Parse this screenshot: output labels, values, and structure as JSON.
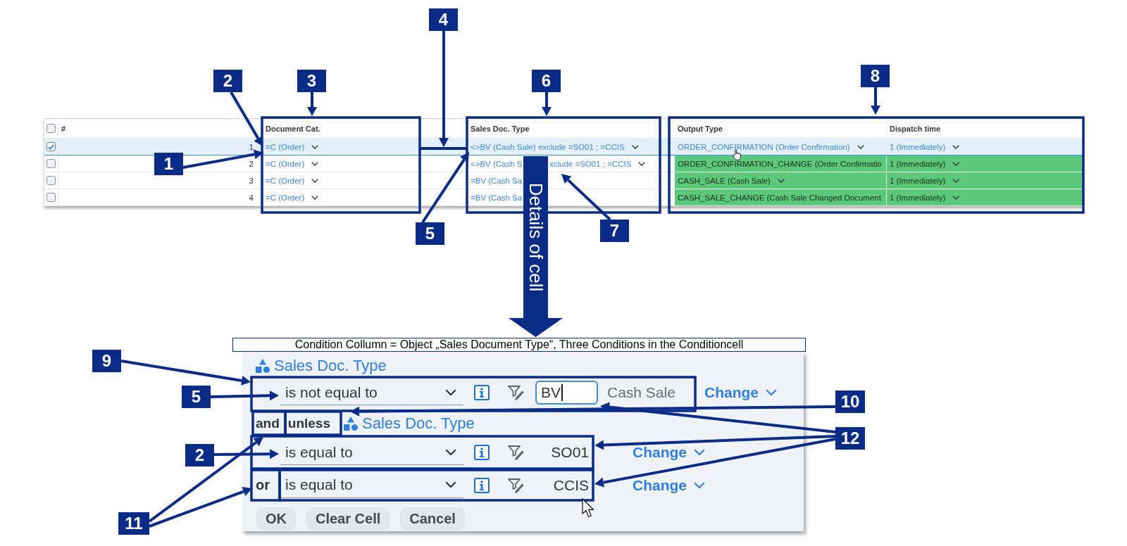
{
  "table": {
    "select_all": {
      "checked": false
    },
    "columns": [
      {
        "label": "#"
      },
      {
        "label": "Document Cat."
      },
      {
        "label": "Sales Doc. Type"
      },
      {
        "label": "Output Type"
      },
      {
        "label": "Dispatch time"
      }
    ],
    "rows": [
      {
        "selected": true,
        "highlighted": false,
        "cells": [
          {
            "text": "1",
            "dropdown": false
          },
          {
            "text": "=C (Order)",
            "dropdown": true
          },
          {
            "text": "<>BV (Cash Sale) exclude =SO01 ; =CCIS",
            "dropdown": true
          },
          {
            "text": "ORDER_CONFIRMATION (Order Confirmation)",
            "dropdown": true
          },
          {
            "text": "1 (Immediately)",
            "dropdown": true
          }
        ]
      },
      {
        "selected": false,
        "highlighted": true,
        "cells": [
          {
            "text": "2",
            "dropdown": false
          },
          {
            "text": "=C (Order)",
            "dropdown": true
          },
          {
            "text": "<>BV (Cash S",
            "continuation": "xclude =SO01 ; =CCIS",
            "dropdown": true
          },
          {
            "text": "ORDER_CONFIRMATION_CHANGE (Order Confirmatio",
            "dropdown": false
          },
          {
            "text": "1 (Immediately)",
            "dropdown": true
          }
        ]
      },
      {
        "selected": false,
        "highlighted": true,
        "cells": [
          {
            "text": "3",
            "dropdown": false
          },
          {
            "text": "=C (Order)",
            "dropdown": true
          },
          {
            "text": "=BV (Cash Sa",
            "dropdown": false
          },
          {
            "text": "CASH_SALE (Cash Sale)",
            "dropdown": true
          },
          {
            "text": "1 (Immediately)",
            "dropdown": true
          }
        ]
      },
      {
        "selected": false,
        "highlighted": true,
        "cells": [
          {
            "text": "4",
            "dropdown": false
          },
          {
            "text": "=C (Order)",
            "dropdown": true
          },
          {
            "text": "=BV (Cash Sa",
            "dropdown": false
          },
          {
            "text": "CASH_SALE_CHANGE (Cash Sale Changed Document",
            "dropdown": false
          },
          {
            "text": "1 (Immediately)",
            "dropdown": true
          }
        ]
      }
    ]
  },
  "details_arrow": {
    "label": "Details of cell"
  },
  "caption": "Condition Collumn = Object „Sales Document Type“, Three Conditions in the Conditioncell",
  "condition_editor": {
    "object": "Sales Doc. Type",
    "conditions": [
      {
        "kind": "input",
        "operator": "is not equal to",
        "value": "BV",
        "description": "Cash Sale",
        "action": "Change"
      }
    ],
    "exception": {
      "joiner": "and",
      "keyword": "unless",
      "object": "Sales Doc. Type",
      "conditions": [
        {
          "kind": "text",
          "operator": "is equal to",
          "value": "SO01",
          "action": "Change"
        },
        {
          "kind": "text",
          "connector": "or",
          "operator": "is equal to",
          "value": "CCIS",
          "action": "Change"
        }
      ]
    },
    "buttons": [
      {
        "label": "OK"
      },
      {
        "label": "Clear Cell"
      },
      {
        "label": "Cancel"
      }
    ]
  },
  "callouts": [
    {
      "label": "4"
    },
    {
      "label": "8"
    },
    {
      "label": "2"
    },
    {
      "label": "3"
    },
    {
      "label": "6"
    },
    {
      "label": "1"
    },
    {
      "label": "7"
    },
    {
      "label": "5"
    },
    {
      "label": "9"
    },
    {
      "label": "5"
    },
    {
      "label": "10"
    },
    {
      "label": "12"
    },
    {
      "label": "2"
    },
    {
      "label": "11"
    }
  ]
}
